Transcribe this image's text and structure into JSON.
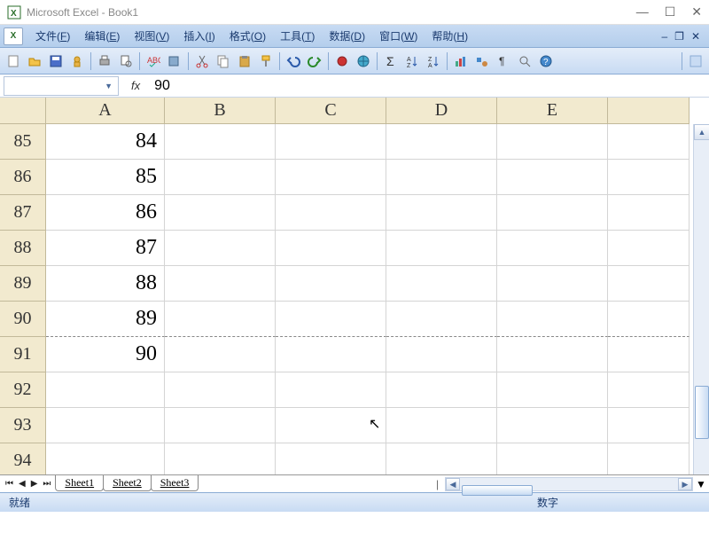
{
  "window": {
    "title": "Microsoft Excel - Book1"
  },
  "menu": {
    "items": [
      {
        "label": "文件(F)",
        "key": "F"
      },
      {
        "label": "编辑(E)",
        "key": "E"
      },
      {
        "label": "视图(V)",
        "key": "V"
      },
      {
        "label": "插入(I)",
        "key": "I"
      },
      {
        "label": "格式(O)",
        "key": "O"
      },
      {
        "label": "工具(T)",
        "key": "T"
      },
      {
        "label": "数据(D)",
        "key": "D"
      },
      {
        "label": "窗口(W)",
        "key": "W"
      },
      {
        "label": "帮助(H)",
        "key": "H"
      }
    ]
  },
  "toolbar_icons": [
    "new-icon",
    "open-icon",
    "save-icon",
    "permission-icon",
    "print-icon",
    "print-preview-icon",
    "spelling-icon",
    "research-icon",
    "cut-icon",
    "copy-icon",
    "paste-icon",
    "format-painter-icon",
    "undo-icon",
    "redo-icon",
    "ink-icon",
    "hyperlink-icon",
    "autosum-icon",
    "sort-asc-icon",
    "sort-desc-icon",
    "chart-icon",
    "drawing-icon",
    "zoom-icon",
    "help-icon"
  ],
  "name_box": {
    "value": ""
  },
  "formula_bar": {
    "fx_label": "fx",
    "value": "90"
  },
  "columns": [
    "A",
    "B",
    "C",
    "D",
    "E"
  ],
  "rows": [
    {
      "num": "85",
      "A": "84"
    },
    {
      "num": "86",
      "A": "85"
    },
    {
      "num": "87",
      "A": "86"
    },
    {
      "num": "88",
      "A": "87"
    },
    {
      "num": "89",
      "A": "88"
    },
    {
      "num": "90",
      "A": "89"
    },
    {
      "num": "91",
      "A": "90"
    },
    {
      "num": "92",
      "A": ""
    },
    {
      "num": "93",
      "A": ""
    },
    {
      "num": "94",
      "A": ""
    }
  ],
  "sheets": [
    "Sheet1",
    "Sheet2",
    "Sheet3"
  ],
  "status": {
    "left": "就绪",
    "right": "数字"
  }
}
